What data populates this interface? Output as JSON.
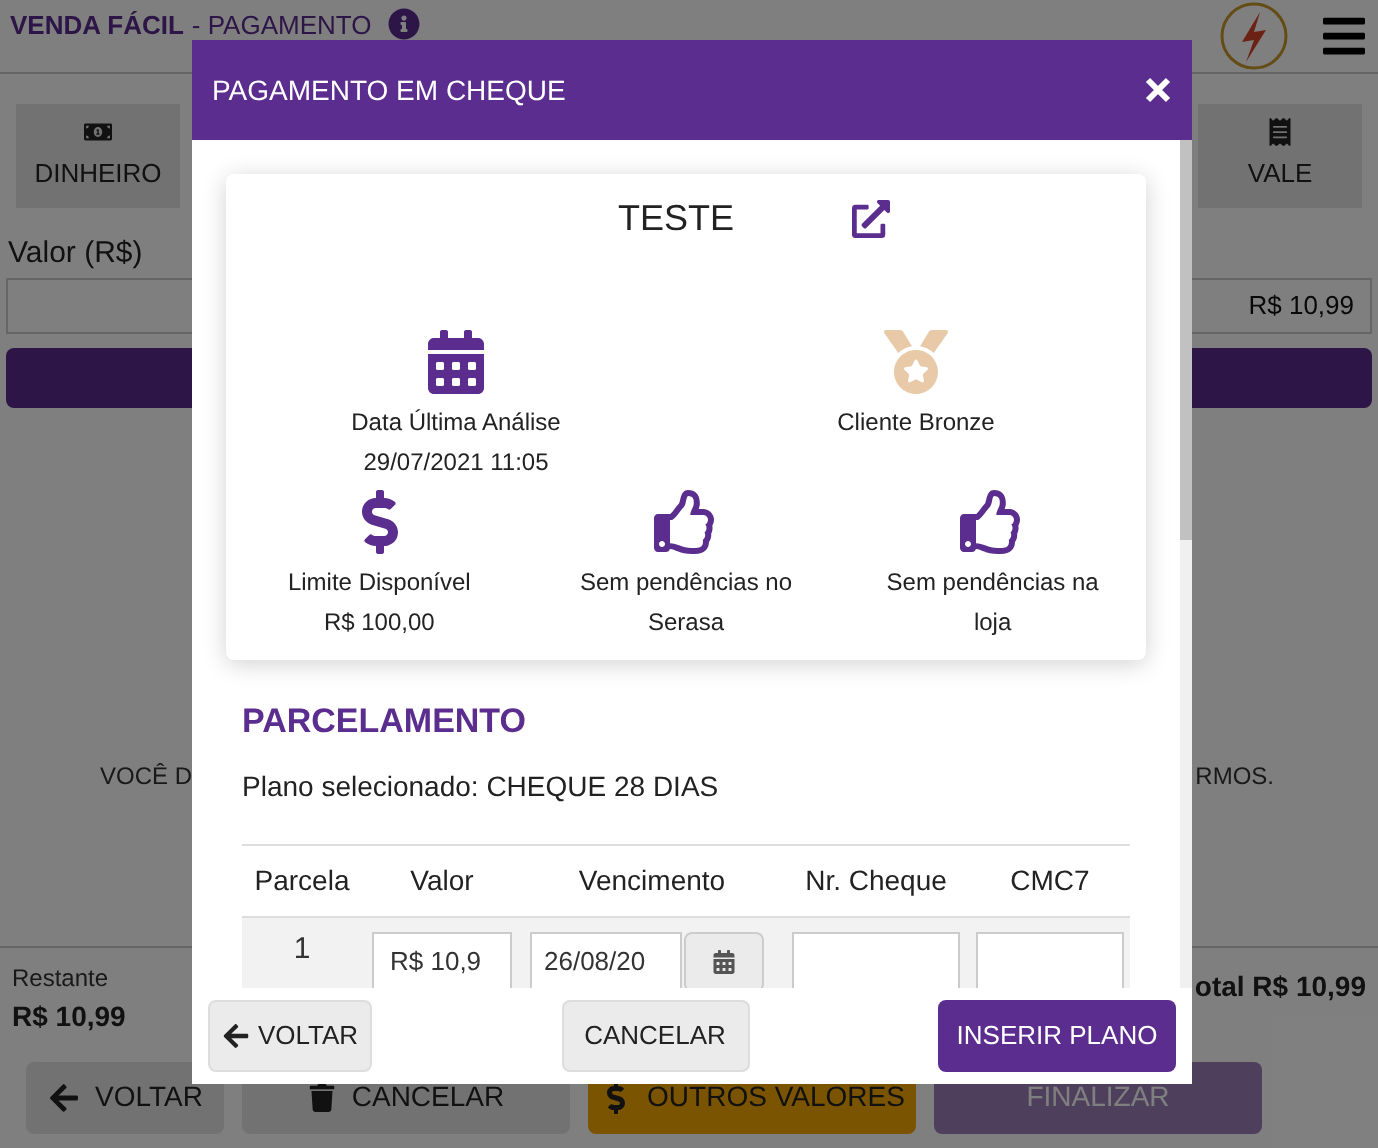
{
  "header": {
    "brand": "VENDA FÁCIL",
    "page": "- PAGAMENTO"
  },
  "payment_methods": [
    {
      "label": "DINHEIRO",
      "kind": "cash"
    },
    {
      "label": "VALE",
      "kind": "voucher"
    }
  ],
  "value_field": {
    "label": "Valor (R$)",
    "value": "R$ 10,99"
  },
  "notice": {
    "left_fragment": "VOCÊ D",
    "right_fragment": "RMOS."
  },
  "summary": {
    "remaining_label": "Restante",
    "remaining_value": "R$ 10,99",
    "total": "otal R$ 10,99"
  },
  "bottom_buttons": [
    {
      "label": "VOLTAR",
      "kind": "back",
      "disabled": false
    },
    {
      "label": "CANCELAR",
      "kind": "cancel",
      "disabled": false
    },
    {
      "label": "OUTROS VALORES",
      "kind": "other",
      "disabled": false
    },
    {
      "label": "FINALIZAR",
      "kind": "finish",
      "disabled": true
    }
  ],
  "modal": {
    "title": "PAGAMENTO EM CHEQUE",
    "customer_name": "TESTE",
    "indicator_rows": [
      [
        {
          "kind": "calendar",
          "label": "Data Última Análise",
          "value": "29/07/2021 11:05"
        },
        {
          "kind": "medal",
          "label": "Cliente Bronze"
        }
      ],
      [
        {
          "kind": "dollar",
          "label": "Limite Disponível",
          "value": "R$ 100,00"
        },
        {
          "kind": "thumbs-up",
          "label": "Sem pendências no Serasa"
        },
        {
          "kind": "thumbs-up",
          "label": "Sem pendências na loja"
        }
      ]
    ],
    "section_title": "PARCELAMENTO",
    "plan_text": "Plano selecionado: CHEQUE 28 DIAS",
    "table": {
      "columns": [
        "Parcela",
        "Valor",
        "Vencimento",
        "Nr. Cheque",
        "CMC7"
      ],
      "rows": [
        {
          "parcela": "1",
          "valor": "R$ 10,9",
          "vencimento": "26/08/20"
        }
      ]
    },
    "buttons": [
      {
        "label": "VOLTAR",
        "kind": "back"
      },
      {
        "label": "CANCELAR",
        "kind": "cancel"
      },
      {
        "label": "INSERIR PLANO",
        "kind": "primary"
      }
    ]
  }
}
